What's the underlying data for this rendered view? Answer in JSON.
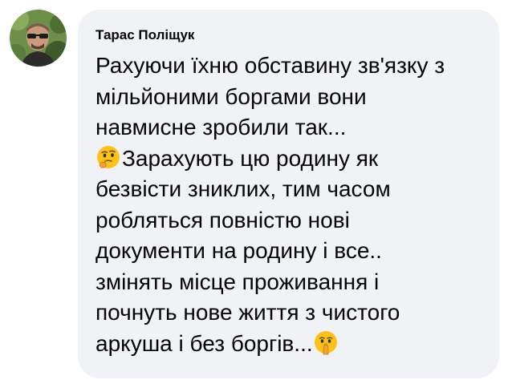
{
  "comment": {
    "author": "Тарас Поліщук",
    "lines": [
      "Рахуючи їхню обставину зв'язку з",
      "мільйоними боргами вони",
      "навмисне зробили так...",
      "Зарахують цю родину як",
      "безвісти зниклих, тим часом",
      "робляться повністю нові",
      "документи на родину і все..",
      "змінять місце проживання і",
      "почнуть нове життя з чистого",
      "аркуша і без боргів..."
    ],
    "emojis": {
      "thinking": "thinking-face",
      "shushing": "shushing-face"
    }
  },
  "colors": {
    "bubble_background": "#f0f2f5",
    "text": "#050505",
    "emoji_yellow": "#fcc21b"
  }
}
